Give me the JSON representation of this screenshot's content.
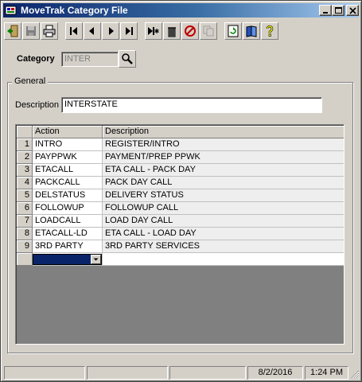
{
  "window": {
    "title": "MoveTrak Category File"
  },
  "toolbar": {
    "buttons": [
      {
        "name": "exit-button",
        "icon": "exit-door-icon"
      },
      {
        "name": "save-button",
        "icon": "floppy-disk-icon"
      },
      {
        "name": "print-button",
        "icon": "printer-icon"
      },
      {
        "name": "first-record-button",
        "icon": "first-record-icon"
      },
      {
        "name": "previous-record-button",
        "icon": "previous-record-icon"
      },
      {
        "name": "next-record-button",
        "icon": "next-record-icon"
      },
      {
        "name": "last-record-button",
        "icon": "last-record-icon"
      },
      {
        "name": "new-record-button",
        "icon": "new-record-icon"
      },
      {
        "name": "delete-button",
        "icon": "trash-can-icon"
      },
      {
        "name": "cancel-button",
        "icon": "cancel-icon"
      },
      {
        "name": "copy-button",
        "icon": "copy-icon"
      },
      {
        "name": "refresh-button",
        "icon": "refresh-icon"
      },
      {
        "name": "lookup-button",
        "icon": "book-icon"
      },
      {
        "name": "help-button",
        "icon": "help-question-icon"
      }
    ]
  },
  "category": {
    "label": "Category",
    "value": "INTER",
    "search_icon": "magnifier-icon"
  },
  "general": {
    "group_label": "General",
    "description_label": "Description",
    "description_value": "INTERSTATE"
  },
  "grid": {
    "columns": [
      "Action",
      "Description"
    ],
    "rows": [
      {
        "num": "1",
        "action": "INTRO",
        "description": "REGISTER/INTRO"
      },
      {
        "num": "2",
        "action": "PAYPPWK",
        "description": "PAYMENT/PREP PPWK"
      },
      {
        "num": "3",
        "action": "ETACALL",
        "description": "ETA CALL - PACK DAY"
      },
      {
        "num": "4",
        "action": "PACKCALL",
        "description": "PACK DAY CALL"
      },
      {
        "num": "5",
        "action": "DELSTATUS",
        "description": "DELIVERY STATUS"
      },
      {
        "num": "6",
        "action": "FOLLOWUP",
        "description": "FOLLOWUP CALL"
      },
      {
        "num": "7",
        "action": "LOADCALL",
        "description": "LOAD DAY CALL"
      },
      {
        "num": "8",
        "action": "ETACALL-LD",
        "description": "ETA CALL - LOAD DAY"
      },
      {
        "num": "9",
        "action": "3RD PARTY",
        "description": "3RD PARTY SERVICES"
      }
    ]
  },
  "statusbar": {
    "date": "8/2/2016",
    "time": "1:24 PM"
  },
  "colors": {
    "title_gradient_start": "#0a246a",
    "title_gradient_end": "#a6caf0",
    "face": "#d4d0c8",
    "selection": "#0a246a"
  }
}
